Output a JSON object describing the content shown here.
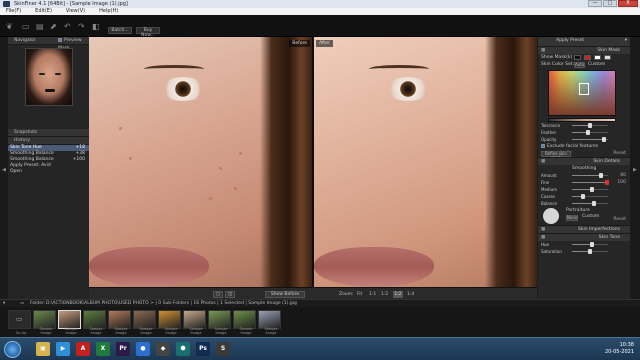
{
  "window": {
    "title": "SkinFiner 4.1 [64Bit] - [Sample Image (1).jpg]",
    "buttons": [
      "—",
      "□",
      "X"
    ]
  },
  "menu": [
    "File(F)",
    "Edit(E)",
    "View(V)",
    "Help(H)"
  ],
  "toolbar": {
    "batch_label": "Batch...",
    "buy_label": "Buy Now..."
  },
  "navigator": {
    "title": "Navigator",
    "preview_mask": "Preview Mask"
  },
  "snapshots": {
    "title": "Snapshots"
  },
  "history": {
    "title": "History",
    "items": [
      {
        "label": "Skin Tone Hue",
        "value": "+18",
        "selected": true
      },
      {
        "label": "Smoothing Balance",
        "value": "+38",
        "selected": false
      },
      {
        "label": "Smoothing Balance",
        "value": "+100",
        "selected": false
      },
      {
        "label": "Apply Preset: Avid",
        "value": "",
        "selected": false
      },
      {
        "label": "Open",
        "value": "",
        "selected": false
      }
    ]
  },
  "canvas": {
    "before_label": "Before",
    "after_label": "After"
  },
  "bottombar": {
    "show_before": "Show Before",
    "zoom_label": "Zoom:",
    "zoom_options": [
      "Fit",
      "1:1",
      "1:2",
      "1:4"
    ],
    "zoom_selected": "1:2"
  },
  "right": {
    "apply_preset": "Apply Preset",
    "skin_mask": {
      "title": "Skin Mask",
      "show_mask_label": "Show Mask(k)",
      "skin_color_label": "Skin Color Set:",
      "auto_label": "Auto",
      "custom_label": "Custom",
      "sliders": [
        {
          "label": "Tolerance",
          "value": "",
          "level": 0.5
        },
        {
          "label": "Feather",
          "value": "",
          "level": 0.45
        },
        {
          "label": "Opacity",
          "value": "",
          "level": 0.9
        }
      ],
      "exclude_label": "Exclude facial features automatically",
      "refine_label": "Refine skin mask",
      "reset_label": "Reset"
    },
    "skin_details": {
      "title": "Skin Details",
      "smoothing_label": "Smoothing",
      "sliders": [
        {
          "label": "Amount",
          "value": "80",
          "level": 0.8
        },
        {
          "label": "Fine",
          "value": "100",
          "level": 0.98
        },
        {
          "label": "Medium",
          "value": "",
          "level": 0.55
        },
        {
          "label": "Coarse",
          "value": "",
          "level": 0.3
        },
        {
          "label": "Balance",
          "value": "",
          "level": 0.6
        }
      ],
      "fine_highlight": "+38",
      "portraiture_label": "Portraiture",
      "none_label": "None",
      "custom_label": "Custom",
      "reset_label": "Reset"
    },
    "skin_imperfections": {
      "title": "Skin Imperfections"
    },
    "skin_tone": {
      "title": "Skin Tone",
      "sliders": [
        {
          "label": "Hue",
          "value": "",
          "level": 0.55
        },
        {
          "label": "Saturation",
          "value": "",
          "level": 0.5
        }
      ]
    }
  },
  "filmstrip": {
    "folder_label": "Folder:",
    "path": "D:\\ACTIONBOOK\\ALBUM PHOTO\\USED PHOTO > | 0 Sub-Folders | 16 Photos | 1 Selected | Sample Image (1).jpg",
    "go_up": "Go Up",
    "thumbs": [
      {
        "label": "Sample Image",
        "color": "#6b8a4a",
        "selected": false
      },
      {
        "label": "Sample Image",
        "color": "#c79a7e",
        "selected": true
      },
      {
        "label": "Sample Image",
        "color": "#5d7d3c",
        "selected": false
      },
      {
        "label": "Sample Image",
        "color": "#b07a5a",
        "selected": false
      },
      {
        "label": "Sample Image",
        "color": "#8a6a50",
        "selected": false
      },
      {
        "label": "Sample Image",
        "color": "#d09030",
        "selected": false
      },
      {
        "label": "Sample Image",
        "color": "#c4a88a",
        "selected": false
      },
      {
        "label": "Sample Image",
        "color": "#7a9a55",
        "selected": false
      },
      {
        "label": "Sample Image",
        "color": "#6f8f48",
        "selected": false
      },
      {
        "label": "Sample Image",
        "color": "#9aa0b4",
        "selected": false
      }
    ]
  },
  "taskbar": {
    "apps": [
      {
        "name": "explorer",
        "glyph": "▣",
        "color": "#d6b24a"
      },
      {
        "name": "media",
        "glyph": "▶",
        "color": "#2f8fd9"
      },
      {
        "name": "acrobat",
        "glyph": "A",
        "color": "#c52020"
      },
      {
        "name": "excel",
        "glyph": "X",
        "color": "#1f7a3e"
      },
      {
        "name": "premiere",
        "glyph": "Pr",
        "color": "#2c1a4a"
      },
      {
        "name": "browser",
        "glyph": "●",
        "color": "#2d6fd1"
      },
      {
        "name": "app",
        "glyph": "◆",
        "color": "#444"
      },
      {
        "name": "hex",
        "glyph": "⬢",
        "color": "#1b6f6f"
      },
      {
        "name": "photoshop",
        "glyph": "Ps",
        "color": "#0f2c52"
      },
      {
        "name": "skinfiner",
        "glyph": "S",
        "color": "#3a3a3a"
      }
    ],
    "time": "10:38",
    "date": "20-05-2021"
  }
}
